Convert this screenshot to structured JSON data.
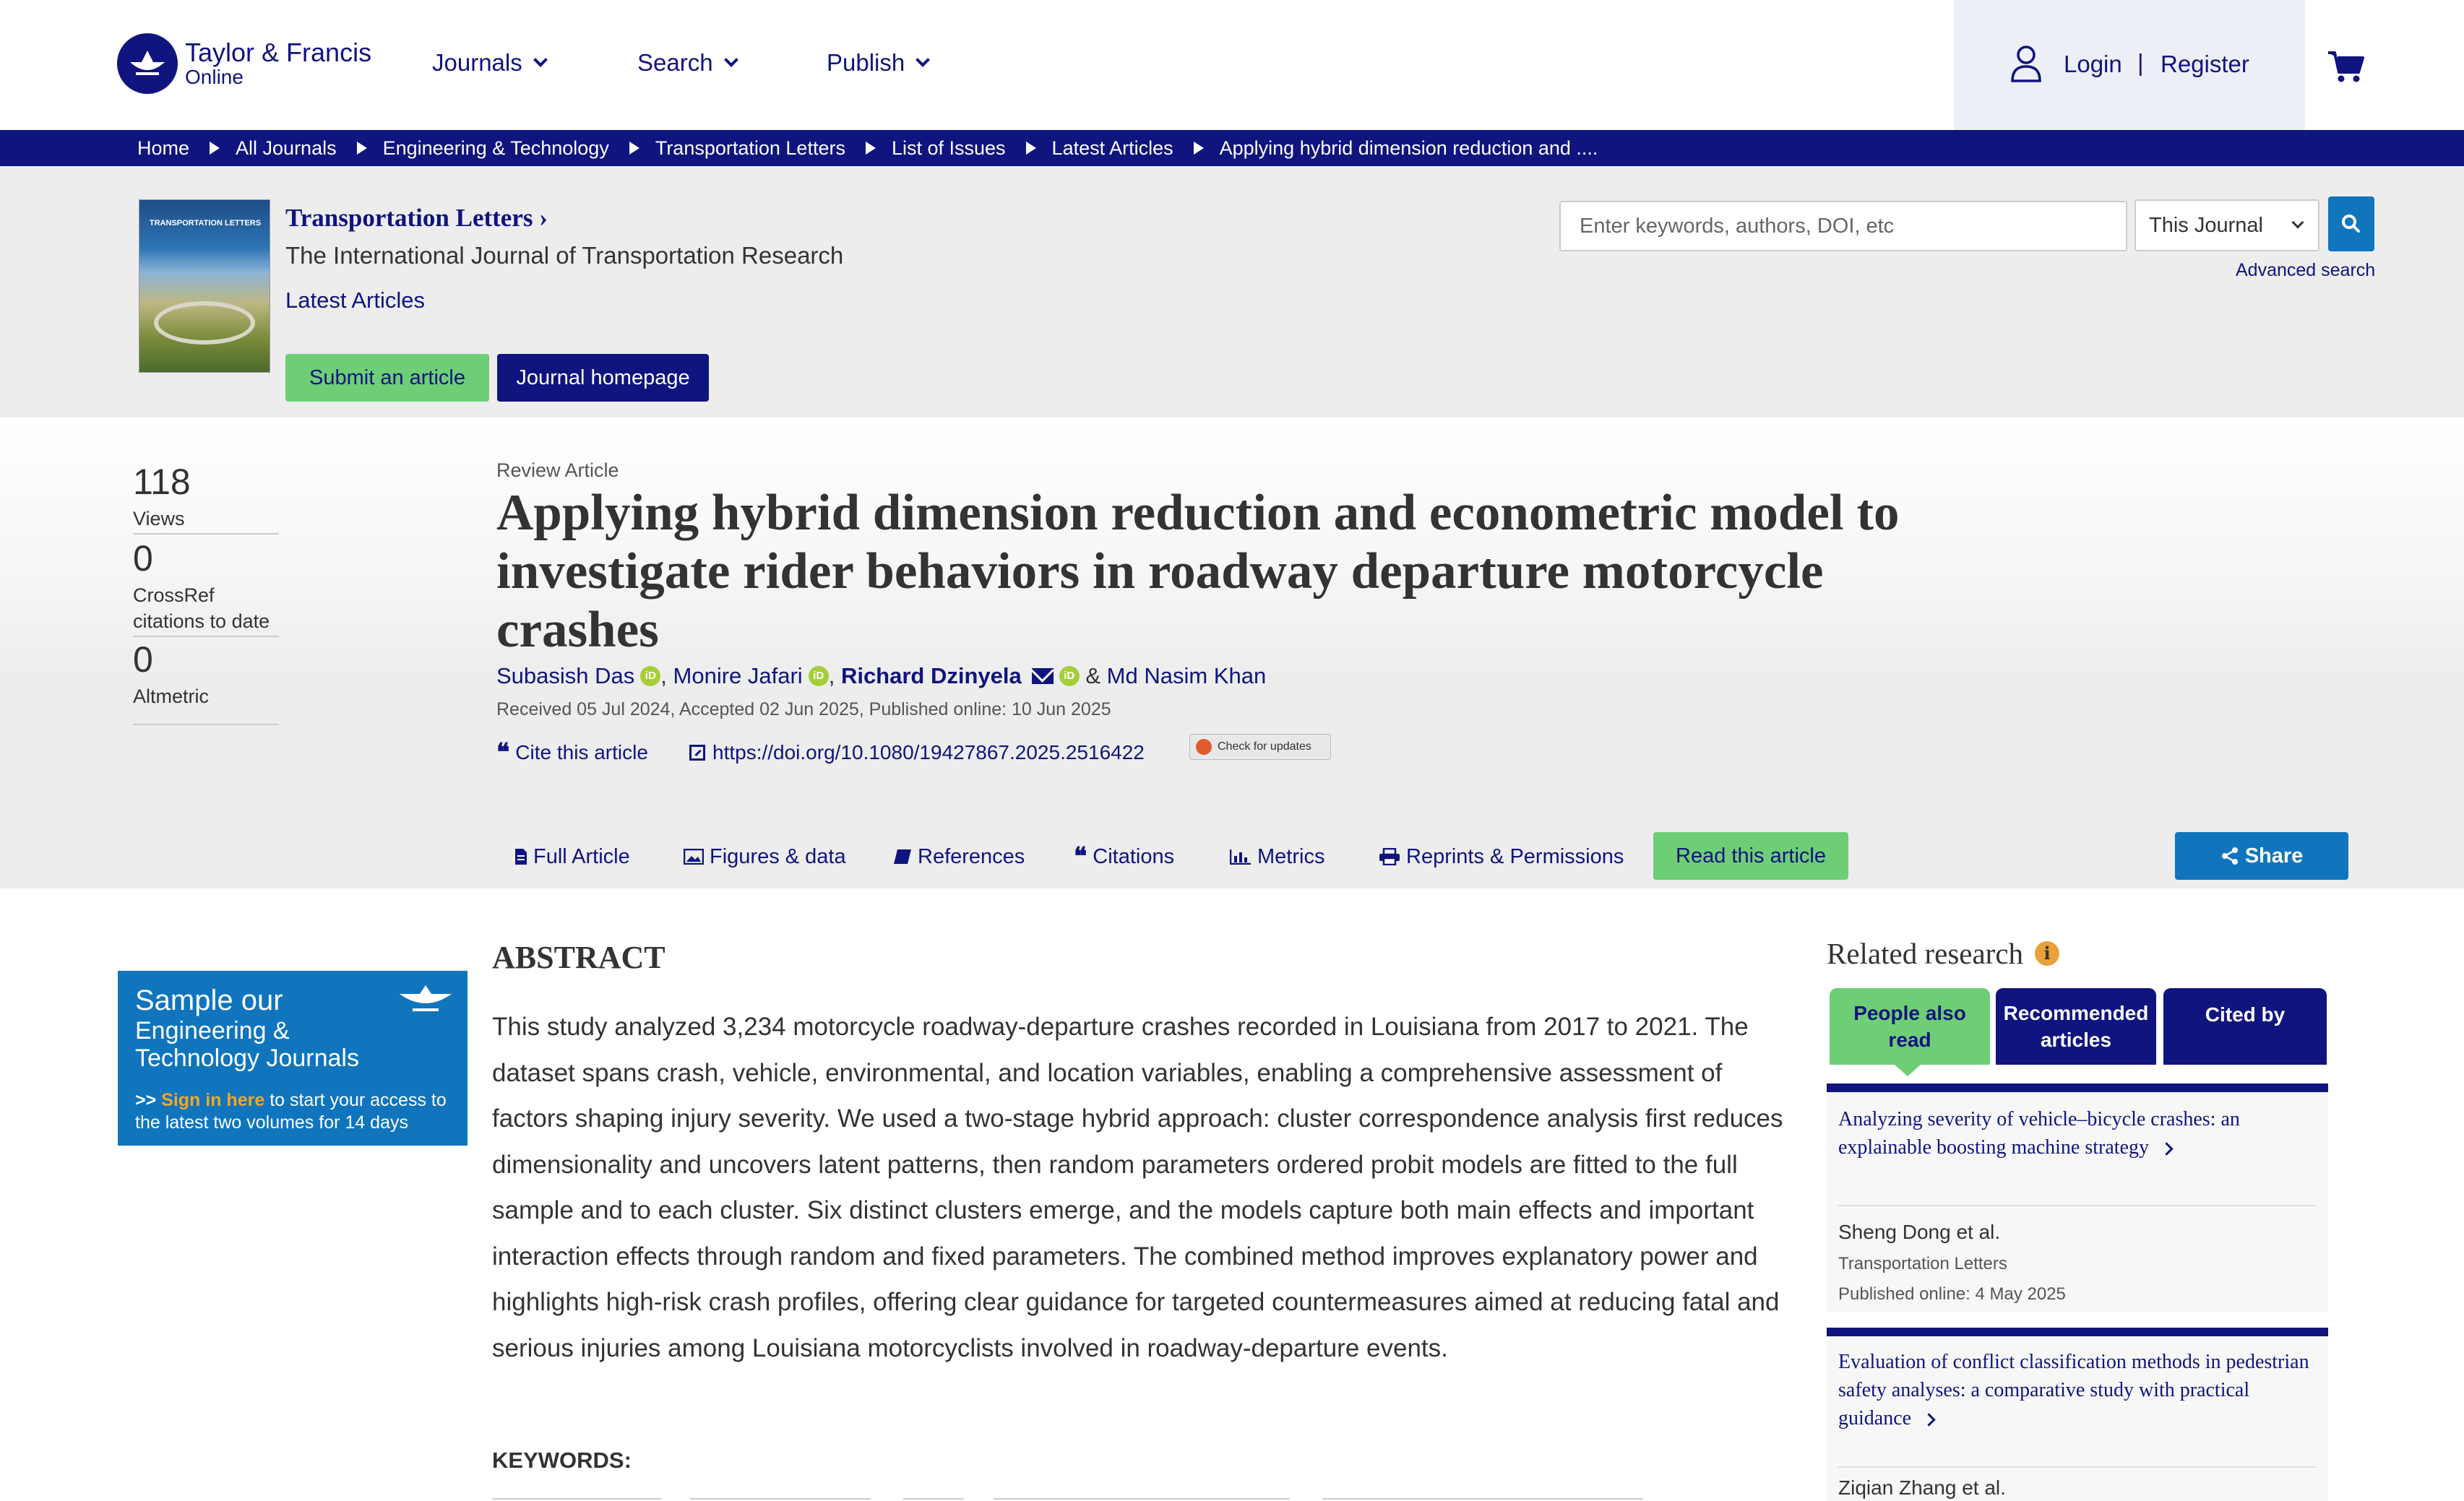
{
  "header": {
    "logo_line1": "Taylor & Francis",
    "logo_line2": "Online",
    "nav": [
      "Journals",
      "Search",
      "Publish"
    ],
    "login": "Login",
    "separator": "|",
    "register": "Register"
  },
  "breadcrumb": [
    "Home",
    "All Journals",
    "Engineering & Technology",
    "Transportation Letters",
    "List of Issues",
    "Latest Articles",
    "Applying hybrid dimension reduction and ...."
  ],
  "journal": {
    "title": "Transportation Letters",
    "title_arrow": "›",
    "subtitle": "The International Journal of Transportation Research",
    "latest_articles": "Latest Articles",
    "submit_label": "Submit an article",
    "homepage_label": "Journal homepage",
    "cover_title": "TRANSPORTATION LETTERS"
  },
  "search": {
    "placeholder": "Enter keywords, authors, DOI, etc",
    "scope": "This Journal",
    "advanced": "Advanced search"
  },
  "metrics": [
    {
      "value": "118",
      "label": "Views"
    },
    {
      "value": "0",
      "label": "CrossRef citations to date"
    },
    {
      "value": "0",
      "label": "Altmetric"
    }
  ],
  "article": {
    "type": "Review Article",
    "title": "Applying hybrid dimension reduction and econometric model to investigate rider behaviors in roadway departure motorcycle crashes",
    "authors": [
      {
        "name": "Subasish Das",
        "orcid": true,
        "bold": false
      },
      {
        "name": "Monire Jafari",
        "orcid": true,
        "bold": false
      },
      {
        "name": "Richard Dzinyela",
        "orcid": true,
        "bold": true,
        "email": true
      },
      {
        "name": "Md Nasim Khan",
        "orcid": false,
        "bold": false
      }
    ],
    "author_separators": [
      ", ",
      ", ",
      " & "
    ],
    "dates": "Received 05 Jul 2024, Accepted 02 Jun 2025, Published online: 10 Jun 2025",
    "cite_label": "Cite this article",
    "doi": "https://doi.org/10.1080/19427867.2025.2516422",
    "check_updates": "Check for updates",
    "orcid_icon": "iD"
  },
  "tabs": [
    {
      "label": "Full Article",
      "icon": "file-icon"
    },
    {
      "label": "Figures & data",
      "icon": "image-icon"
    },
    {
      "label": "References",
      "icon": "book-icon"
    },
    {
      "label": "Citations",
      "icon": "quote-icon"
    },
    {
      "label": "Metrics",
      "icon": "bar-chart-icon"
    },
    {
      "label": "Reprints & Permissions",
      "icon": "print-icon"
    }
  ],
  "read_article": "Read this article",
  "share": "Share",
  "sample_ad": {
    "line1": "Sample our",
    "line2": "Engineering & Technology Journals",
    "body_prefix": ">> ",
    "body_highlight": "Sign in here",
    "body_rest": " to start your access to the latest two volumes for 14 days"
  },
  "abstract": {
    "heading": "ABSTRACT",
    "text": "This study analyzed 3,234 motorcycle roadway-departure crashes recorded in Louisiana from 2017 to 2021. The dataset spans crash, vehicle, environmental, and location variables, enabling a comprehensive assessment of factors shaping injury severity. We used a two-stage hybrid approach: cluster correspondence analysis first reduces dimensionality and uncovers latent patterns, then random parameters ordered probit models are fitted to the full sample and to each cluster. Six distinct clusters emerge, and the models capture both main effects and important interaction effects through random and fixed parameters. The combined method improves explanatory power and highlights high-risk crash profiles, offering clear guidance for targeted countermeasures aimed at reducing fatal and serious injuries among Louisiana motorcyclists involved in roadway-departure events.",
    "keywords_label": "KEYWORDS:"
  },
  "related": {
    "heading": "Related research",
    "info_icon": "i",
    "tabs": [
      "People also read",
      "Recommended articles",
      "Cited by"
    ],
    "items": [
      {
        "title": "Analyzing severity of vehicle–bicycle crashes: an explainable boosting machine strategy",
        "author": "Sheng Dong et al.",
        "journal": "Transportation Letters",
        "date": "Published online: 4 May 2025"
      },
      {
        "title": "Evaluation of conflict classification methods in pedestrian safety analyses: a comparative study with practical guidance",
        "author": "Ziqian Zhang et al."
      }
    ]
  },
  "colors": {
    "brand_navy": "#10147e",
    "accent_green": "#6ece75",
    "accent_blue": "#1075bd",
    "orcid_green": "#a6ce39"
  }
}
